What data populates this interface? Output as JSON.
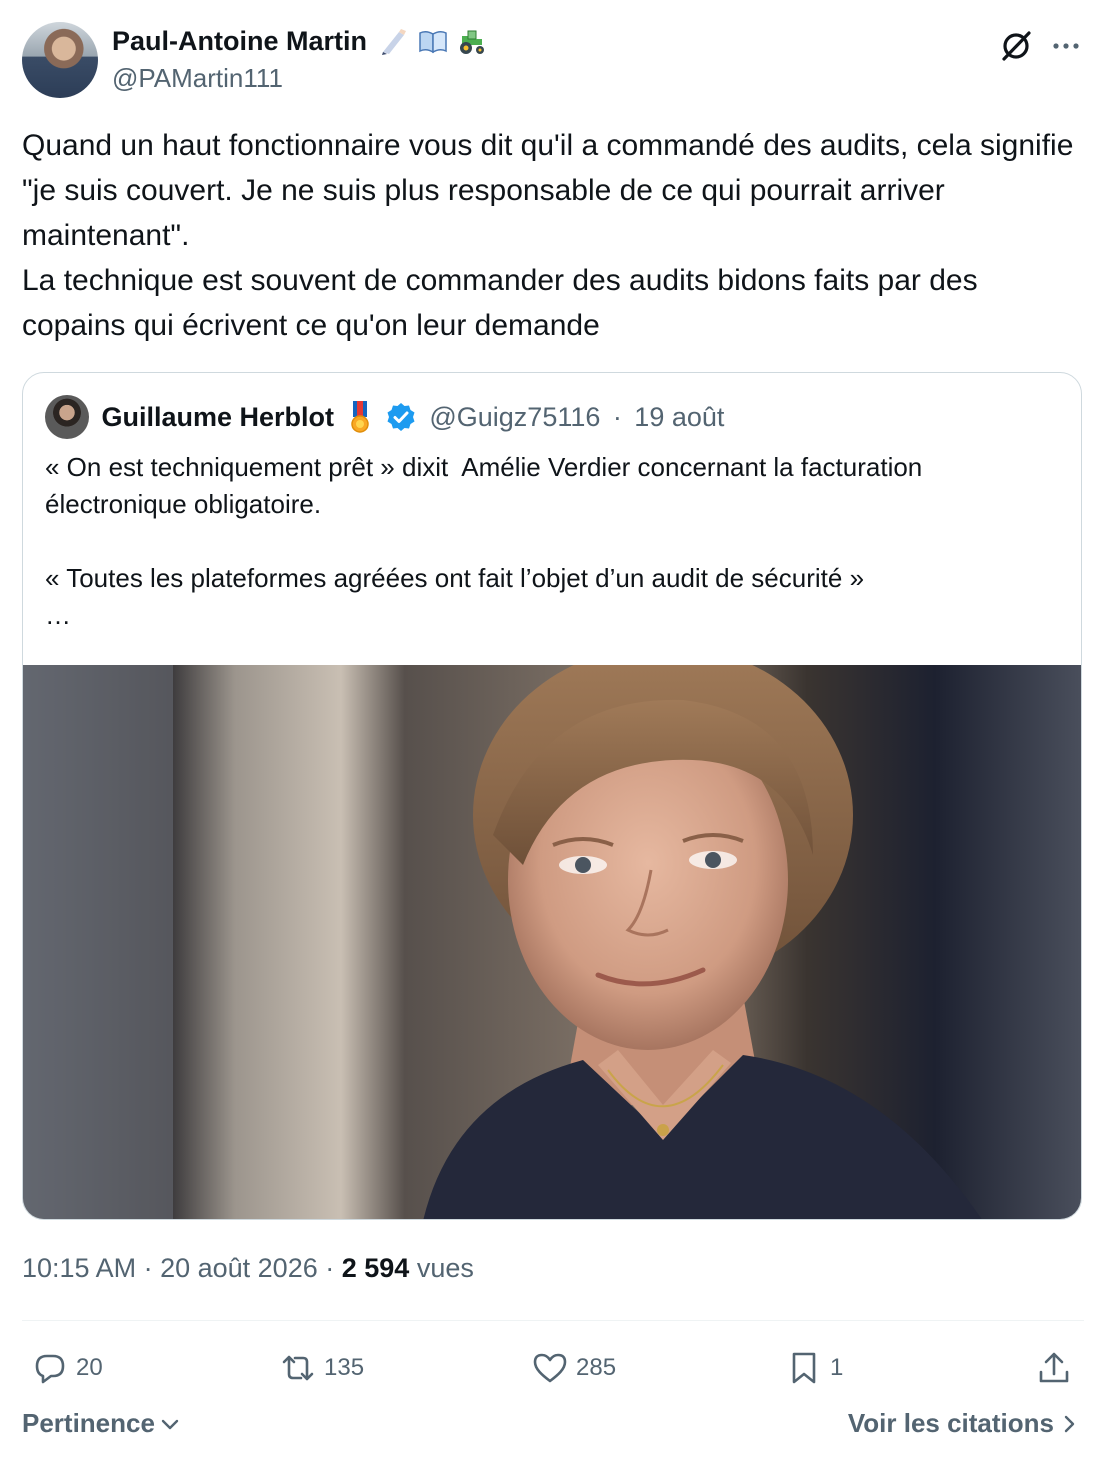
{
  "tweet": {
    "author_name": "Paul-Antoine Martin",
    "author_emojis": [
      "writing-hand-emoji",
      "open-book-emoji",
      "tractor-emoji"
    ],
    "author_handle": "@PAMartin111",
    "text": "Quand un haut fonctionnaire vous dit qu'il a commandé des audits, cela signifie \"je suis couvert. Je ne suis plus responsable de ce qui pourrait arriver maintenant\".\nLa technique est souvent de commander des audits bidons faits par des copains qui écrivent ce qu'on leur demande"
  },
  "quoted": {
    "author_name": "Guillaume Herblot",
    "author_handle": "@Guigz75116",
    "separator": "·",
    "date": "19 août",
    "text": "« On est techniquement prêt » dixit  Amélie Verdier concernant la facturation électronique obligatoire.\n\n« Toutes les plateformes agréées ont fait l’objet d’un audit de sécurité »\n…"
  },
  "meta": {
    "time": "10:15 AM",
    "sep1": " · ",
    "date": "20 août 2026",
    "sep2": " · ",
    "views": "2 594",
    "views_label": " vues"
  },
  "actions": {
    "replies": "20",
    "reposts": "135",
    "likes": "285",
    "bookmarks": "1"
  },
  "footer": {
    "sort_label": "Pertinence",
    "quotes_label": "Voir les citations"
  },
  "colors": {
    "text": "#0f1419",
    "secondary": "#536471",
    "border": "#cfd9de",
    "verified": "#1d9bf0"
  }
}
